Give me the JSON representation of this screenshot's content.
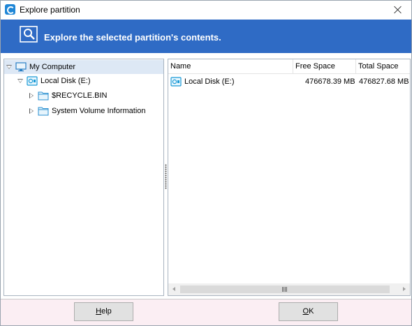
{
  "window": {
    "title": "Explore partition"
  },
  "banner": {
    "text": "Explore the selected partition's contents."
  },
  "tree": {
    "root": {
      "label": "My Computer",
      "icon": "monitor-icon"
    },
    "disk": {
      "label": "Local Disk (E:)",
      "icon": "disk-icon"
    },
    "folders": [
      {
        "label": "$RECYCLE.BIN",
        "icon": "folder-icon"
      },
      {
        "label": "System Volume Information",
        "icon": "folder-icon"
      }
    ]
  },
  "list": {
    "columns": [
      "Name",
      "Free Space",
      "Total Space"
    ],
    "rows": [
      {
        "name": "Local Disk (E:)",
        "free": "476678.39 MB",
        "total": "476827.68 MB"
      }
    ]
  },
  "buttons": {
    "help": {
      "mnemonic": "H",
      "rest": "elp"
    },
    "ok": {
      "mnemonic": "O",
      "rest": "K"
    }
  },
  "colors": {
    "banner": "#2f6bc5",
    "footer": "#fbeef3",
    "selection": "#dde8f5",
    "disk_icon": "#1a9ad6"
  }
}
